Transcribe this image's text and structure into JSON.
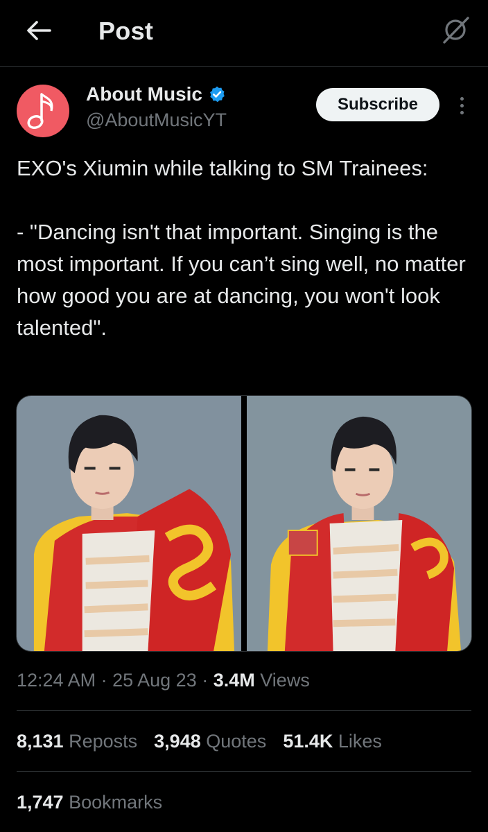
{
  "header": {
    "title": "Post",
    "back_icon": "arrow-left-icon",
    "grok_icon": "grok-icon"
  },
  "author": {
    "name": "About Music",
    "handle": "@AboutMusicYT",
    "verified": true,
    "avatar_icon": "music-note-icon",
    "avatar_color": "#f05a63",
    "verified_color": "#1d9bf0"
  },
  "subscribe_label": "Subscribe",
  "tweet": {
    "line1": "EXO's Xiumin while talking to SM Trainees:",
    "line2": "- \"Dancing isn't that important. Singing is the most important. If you can’t sing well, no matter how good you are at dancing, you won't look talented\"."
  },
  "media": {
    "count": 2
  },
  "meta": {
    "time": "12:24 AM",
    "date": "25 Aug 23",
    "views_count": "3.4M",
    "views_label": "Views"
  },
  "stats": {
    "reposts_count": "8,131",
    "reposts_label": "Reposts",
    "quotes_count": "3,948",
    "quotes_label": "Quotes",
    "likes_count": "51.4K",
    "likes_label": "Likes",
    "bookmarks_count": "1,747",
    "bookmarks_label": "Bookmarks"
  }
}
